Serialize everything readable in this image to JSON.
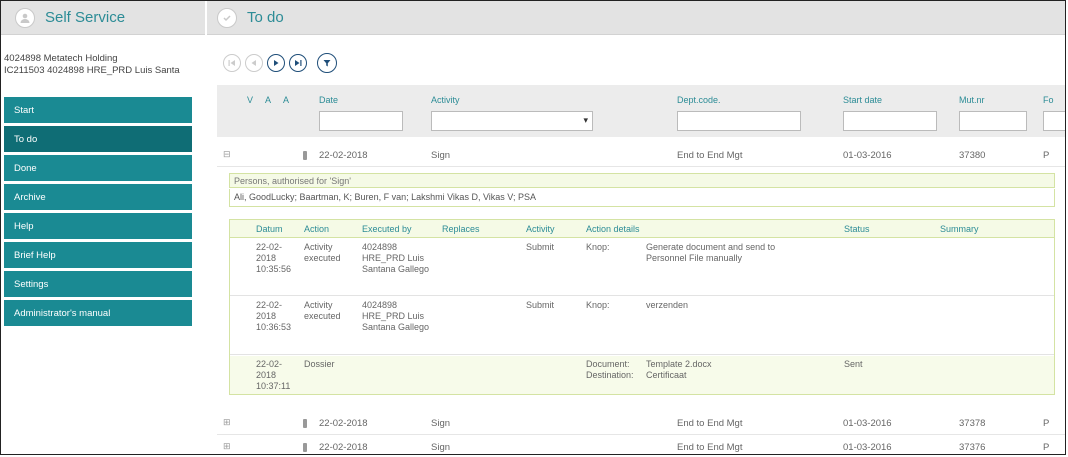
{
  "header": {
    "left_title": "Self Service",
    "right_title": "To do"
  },
  "user": {
    "line1": "4024898 Metatech Holding",
    "line2": "IC211503 4024898 HRE_PRD Luis Santa"
  },
  "nav": [
    {
      "label": "Start"
    },
    {
      "label": "To do"
    },
    {
      "label": "Done"
    },
    {
      "label": "Archive"
    },
    {
      "label": "Help"
    },
    {
      "label": "Brief Help"
    },
    {
      "label": "Settings"
    },
    {
      "label": "Administrator's manual"
    }
  ],
  "grid": {
    "columns": {
      "v": "V",
      "a1": "A",
      "a2": "A",
      "date": "Date",
      "activity": "Activity",
      "dept": "Dept.code.",
      "start": "Start date",
      "mut": "Mut.nr",
      "extra": "Fo"
    },
    "rows": [
      {
        "date": "22-02-2018",
        "activity": "Sign",
        "dept": "End to End Mgt",
        "start": "01-03-2016",
        "mut": "37380",
        "extra": "P",
        "expand": "⊟"
      },
      {
        "date": "22-02-2018",
        "activity": "Sign",
        "dept": "End to End Mgt",
        "start": "01-03-2016",
        "mut": "37378",
        "extra": "P",
        "expand": "⊞"
      },
      {
        "date": "22-02-2018",
        "activity": "Sign",
        "dept": "End to End Mgt",
        "start": "01-03-2016",
        "mut": "37376",
        "extra": "P",
        "expand": "⊞"
      }
    ]
  },
  "authorised": {
    "title": "Persons, authorised for 'Sign'",
    "list": "Ali, GoodLucky; Baartman, K; Buren, F van; Lakshmi Vikas D, Vikas V; PSA"
  },
  "history": {
    "columns": {
      "datum": "Datum",
      "action": "Action",
      "executed_by": "Executed by",
      "replaces": "Replaces",
      "activity": "Activity",
      "details": "Action details",
      "status": "Status",
      "summary": "Summary"
    },
    "rows": [
      {
        "datum": "22-02-2018 10:35:56",
        "action": "Activity executed",
        "executed_by": "4024898 HRE_PRD Luis Santana Gallego",
        "activity": "Submit",
        "detail_key": "Knop:",
        "detail_val": "Generate document and send to Personnel File manually",
        "status": ""
      },
      {
        "datum": "22-02-2018 10:36:53",
        "action": "Activity executed",
        "executed_by": "4024898 HRE_PRD Luis Santana Gallego",
        "activity": "Submit",
        "detail_key": "Knop:",
        "detail_val": "verzenden",
        "status": ""
      },
      {
        "datum": "22-02-2018 10:37:11",
        "action": "Dossier",
        "executed_by": "",
        "activity": "",
        "detail_key": "Document: Destination:",
        "detail_val": "Template 2.docx Certificaat",
        "status": "Sent"
      }
    ]
  },
  "colors": {
    "accent": "#1a8a93",
    "accent_dark": "#0f6d75",
    "link": "#2c8c96"
  }
}
